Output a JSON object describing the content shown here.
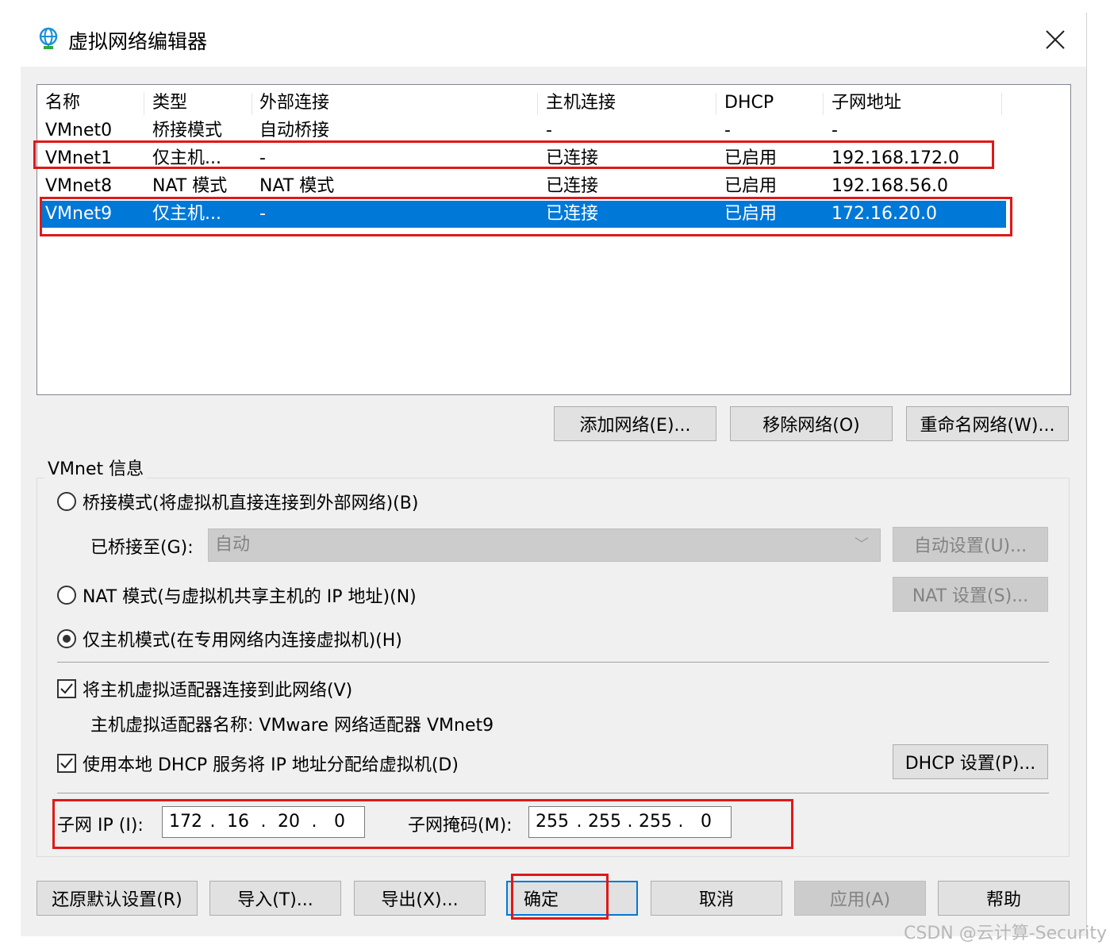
{
  "window": {
    "title": "虚拟网络编辑器",
    "icon": "globe-network-icon",
    "close_icon": "close-x-icon"
  },
  "network_list": {
    "columns": [
      "名称",
      "类型",
      "外部连接",
      "主机连接",
      "DHCP",
      "子网地址"
    ],
    "rows": [
      {
        "name": "VMnet0",
        "type": "桥接模式",
        "external": "自动桥接",
        "host": "-",
        "dhcp": "-",
        "subnet": "-"
      },
      {
        "name": "VMnet1",
        "type": "仅主机...",
        "external": "-",
        "host": "已连接",
        "dhcp": "已启用",
        "subnet": "192.168.172.0"
      },
      {
        "name": "VMnet8",
        "type": "NAT 模式",
        "external": "NAT 模式",
        "host": "已连接",
        "dhcp": "已启用",
        "subnet": "192.168.56.0"
      },
      {
        "name": "VMnet9",
        "type": "仅主机...",
        "external": "-",
        "host": "已连接",
        "dhcp": "已启用",
        "subnet": "172.16.20.0"
      }
    ],
    "selected_row": "VMnet9"
  },
  "list_buttons": {
    "add": "添加网络(E)...",
    "remove": "移除网络(O)",
    "rename": "重命名网络(W)..."
  },
  "vmnet_info": {
    "group_label": "VMnet 信息",
    "bridged_label": "桥接模式(将虚拟机直接连接到外部网络)(B)",
    "bridged_to_label": "已桥接至(G):",
    "bridged_to_value": "自动",
    "auto_settings_button": "自动设置(U)...",
    "nat_label": "NAT 模式(与虚拟机共享主机的 IP 地址)(N)",
    "nat_settings_button": "NAT 设置(S)...",
    "host_only_label": "仅主机模式(在专用网络内连接虚拟机)(H)",
    "selected_mode": "host_only",
    "connect_adapter_label": "将主机虚拟适配器连接到此网络(V)",
    "connect_adapter_checked": true,
    "adapter_name_text": "主机虚拟适配器名称: VMware 网络适配器 VMnet9",
    "dhcp_label": "使用本地 DHCP 服务将 IP 地址分配给虚拟机(D)",
    "dhcp_checked": true,
    "dhcp_settings_button": "DHCP 设置(P)...",
    "subnet_ip_label": "子网 IP (I):",
    "subnet_ip": [
      "172",
      "16",
      "20",
      "0"
    ],
    "subnet_mask_label": "子网掩码(M):",
    "subnet_mask": [
      "255",
      "255",
      "255",
      "0"
    ]
  },
  "footer_buttons": {
    "restore": "还原默认设置(R)",
    "import": "导入(T)...",
    "export": "导出(X)...",
    "ok": "确定",
    "cancel": "取消",
    "apply": "应用(A)",
    "help": "帮助"
  },
  "watermark": "CSDN @云计算-Security",
  "colors": {
    "selection": "#0078d7",
    "highlight_annotation": "#e01818",
    "dialog_bg": "#f0f0f0"
  }
}
